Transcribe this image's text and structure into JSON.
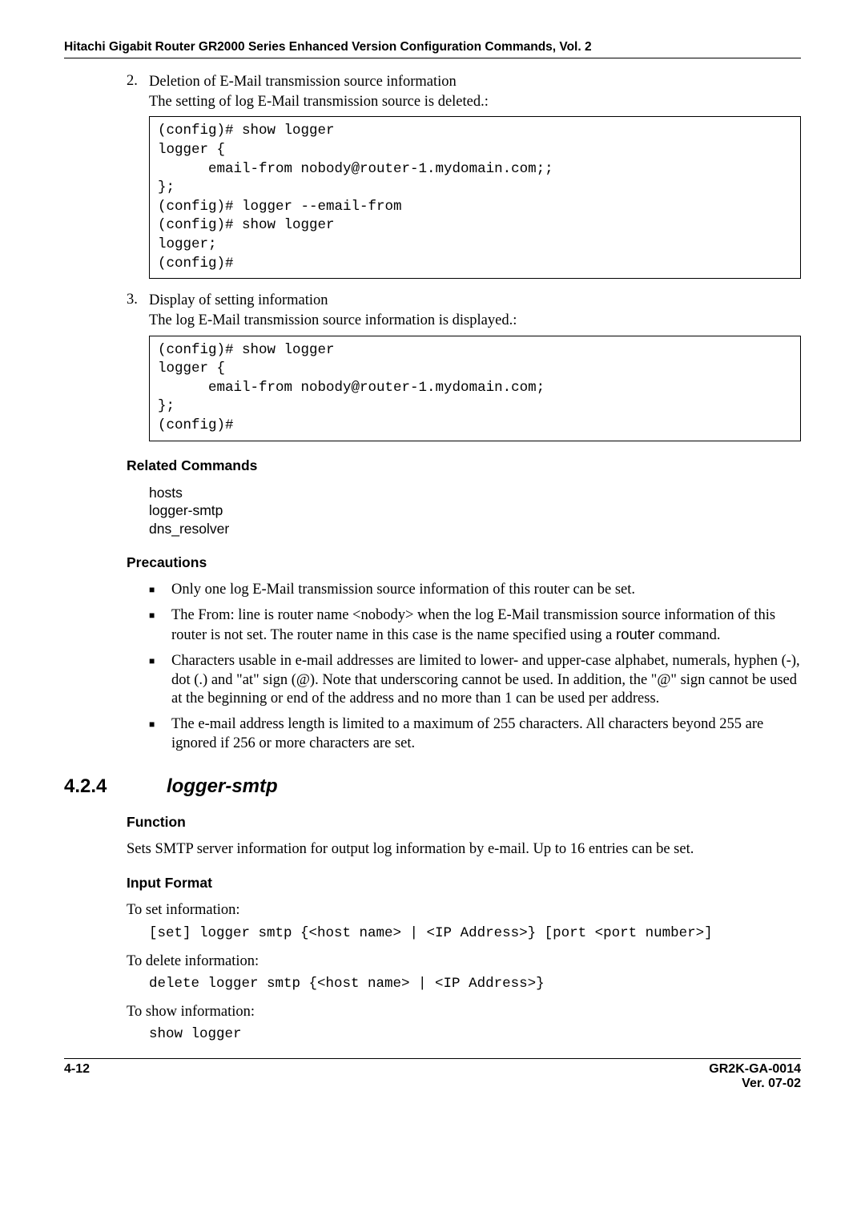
{
  "header": {
    "title": "Hitachi Gigabit Router GR2000 Series Enhanced Version Configuration Commands, Vol. 2"
  },
  "item2": {
    "num": "2.",
    "title": "Deletion of E-Mail transmission source information",
    "subtitle": "The setting of log E-Mail transmission source is deleted.:",
    "code": "(config)# show logger\nlogger {\n      email-from nobody@router-1.mydomain.com;;\n};\n(config)# logger --email-from\n(config)# show logger\nlogger;\n(config)#"
  },
  "item3": {
    "num": "3.",
    "title": "Display of setting information",
    "subtitle": "The log E-Mail transmission source information is displayed.:",
    "code": "(config)# show logger\nlogger {\n      email-from nobody@router-1.mydomain.com;\n};\n(config)#"
  },
  "related": {
    "heading": "Related Commands",
    "lines": "hosts\nlogger-smtp\ndns_resolver"
  },
  "precautions": {
    "heading": "Precautions",
    "b1": "Only one log E-Mail transmission source information of this router can be set.",
    "b2a": "The From: line is router name <nobody> when the log E-Mail transmission source information of this router is not set. The router name in this case is the name specified using a ",
    "b2cmd": "router",
    "b2b": " command.",
    "b3": "Characters usable in e-mail addresses are limited to lower- and upper-case alphabet, numerals, hyphen (-), dot (.) and \"at\" sign (@).  Note that underscoring cannot be used.  In addition, the \"@\" sign cannot be used at the beginning or end of the address and no more than 1 can be used per address.",
    "b4": "The e-mail address length is limited to a maximum of 255 characters.  All characters beyond 255 are ignored if 256 or more characters are set."
  },
  "section": {
    "num": "4.2.4",
    "title": "logger-smtp"
  },
  "function": {
    "heading": "Function",
    "text": "Sets SMTP server information for output log information by e-mail. Up to 16 entries can be set."
  },
  "input": {
    "heading": "Input Format",
    "set_label": "To set information:",
    "set_code": "[set] logger smtp {<host name> | <IP Address>} [port <port number>]",
    "del_label": "To delete information:",
    "del_code": "delete logger smtp {<host name> | <IP Address>}",
    "show_label": "To show information:",
    "show_code": "show logger"
  },
  "footer": {
    "left": "4-12",
    "right1": "GR2K-GA-0014",
    "right2": "Ver. 07-02"
  }
}
